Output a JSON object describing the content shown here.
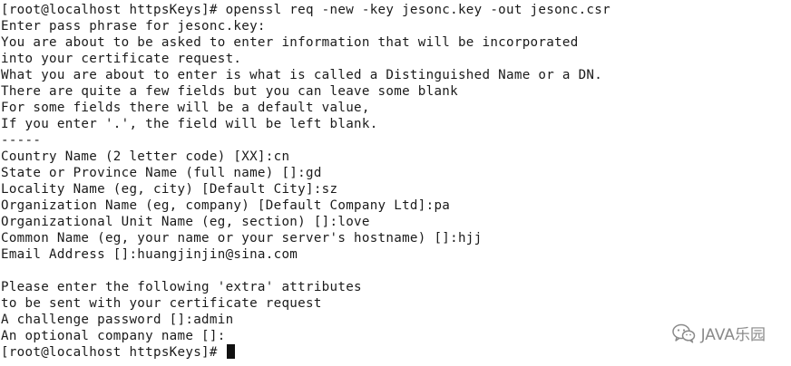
{
  "terminal": {
    "lines": [
      "[root@localhost httpsKeys]# openssl req -new -key jesonc.key -out jesonc.csr",
      "Enter pass phrase for jesonc.key:",
      "You are about to be asked to enter information that will be incorporated",
      "into your certificate request.",
      "What you are about to enter is what is called a Distinguished Name or a DN.",
      "There are quite a few fields but you can leave some blank",
      "For some fields there will be a default value,",
      "If you enter '.', the field will be left blank.",
      "-----",
      "Country Name (2 letter code) [XX]:cn",
      "State or Province Name (full name) []:gd",
      "Locality Name (eg, city) [Default City]:sz",
      "Organization Name (eg, company) [Default Company Ltd]:pa",
      "Organizational Unit Name (eg, section) []:love",
      "Common Name (eg, your name or your server's hostname) []:hjj",
      "Email Address []:huangjinjin@sina.com",
      "",
      "Please enter the following 'extra' attributes",
      "to be sent with your certificate request",
      "A challenge password []:admin",
      "An optional company name []:",
      "[root@localhost httpsKeys]# "
    ]
  },
  "watermark": {
    "icon": "wechat-icon",
    "text": "JAVA乐园"
  },
  "colors": {
    "background": "#ffffff",
    "text": "#1a1a1a",
    "watermark": "#8a8a8a"
  }
}
